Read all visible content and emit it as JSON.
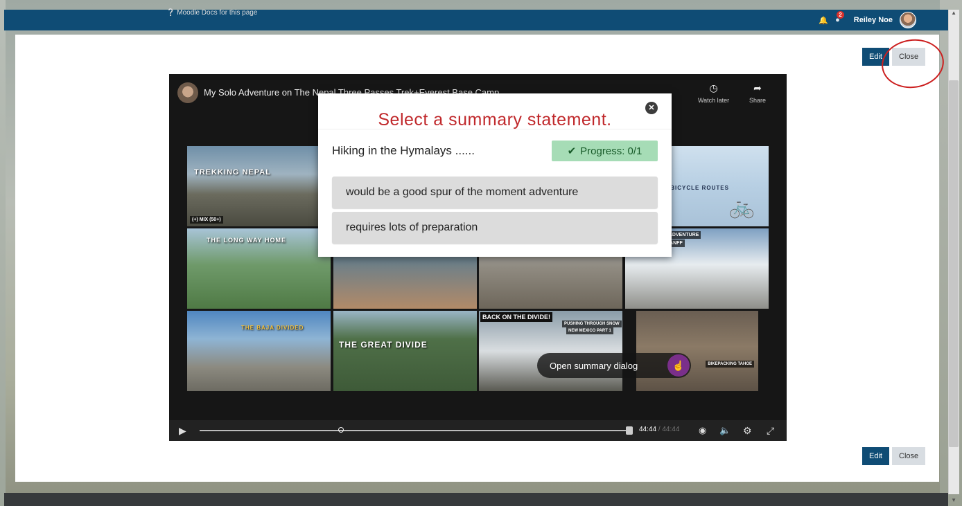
{
  "topbar": {
    "notification_count": "2",
    "user_name": "Reiley Noe"
  },
  "page": {
    "edit_label": "Edit",
    "close_label": "Close"
  },
  "footer": {
    "docs_label": "Moodle Docs for this page"
  },
  "video": {
    "title": "My Solo Adventure on The Nepal Three Passes Trek+Everest Base Camp",
    "watch_later": "Watch later",
    "share": "Share",
    "tiles": {
      "t1_label": "TREKKING NEPAL",
      "t1_tag": "(+) MIX (50+)",
      "t2_label": "THE LONG WAY HOME",
      "t3_label": "THE BAJA DIVIDED",
      "t4_label": "THE GREAT DIVIDE",
      "t5_label": "BACK ON THE DIVIDE!",
      "t5_tag1": "PUSHING THROUGH SNOW",
      "t5_tag2": "NEW MEXICO PART 1",
      "t6_label": "SS COUNTRY BICYCLE ROUTES",
      "t7_label": "ON'S BACKYARD ADVENTURE",
      "t7_tag": "OZEN LAKES IN BANFF",
      "t8_tag": "BIKEPACKING TAHOE"
    },
    "open_summary": "Open summary dialog",
    "time_current": "44:44",
    "time_total": "/ 44:44"
  },
  "dialog": {
    "title": "Select a summary statement.",
    "question": "Hiking in the Hymalays ......",
    "progress": "Progress: 0/1",
    "options": [
      "would be a good spur of the moment adventure",
      "requires lots of preparation"
    ]
  },
  "colors": {
    "brand": "#0f4c75",
    "dialog_title": "#c0282b",
    "progress_bg": "#a6dcb6",
    "annotation": "#cc1f1f"
  }
}
